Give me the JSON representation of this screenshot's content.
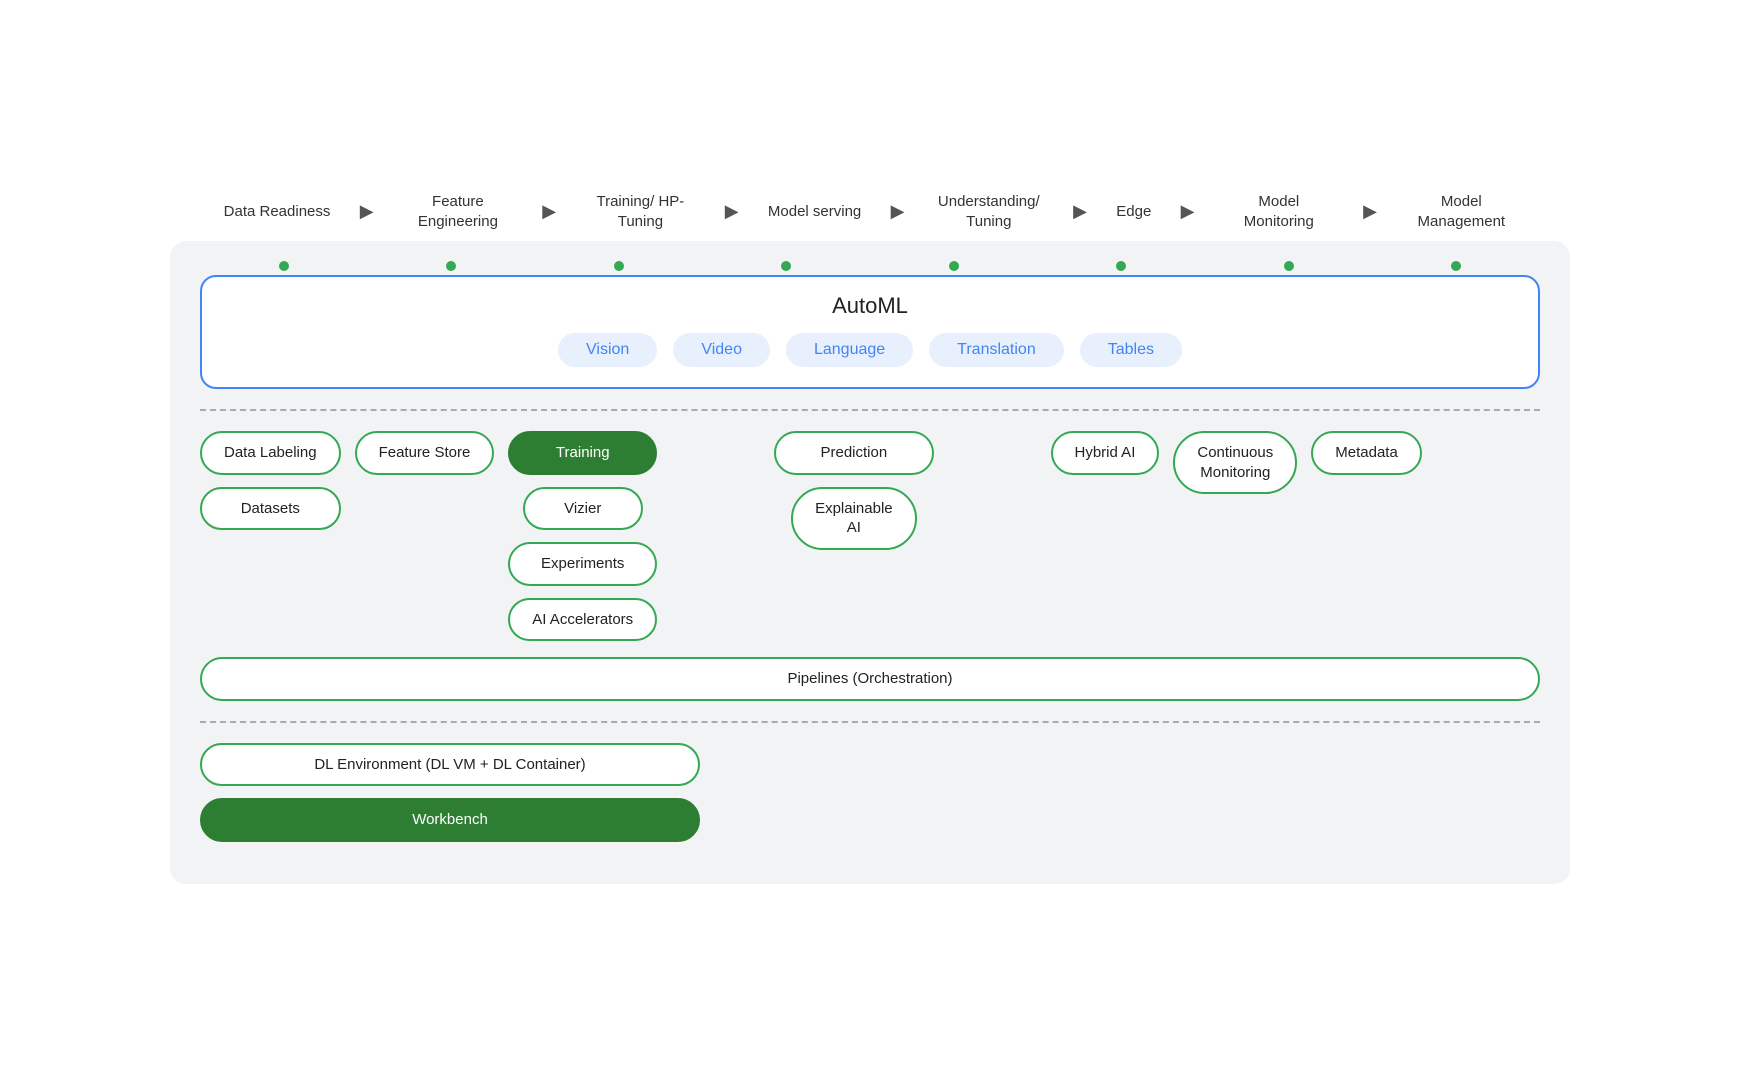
{
  "pipeline": {
    "steps": [
      {
        "label": "Data Readiness"
      },
      {
        "label": "Feature Engineering"
      },
      {
        "label": "Training/ HP-Tuning"
      },
      {
        "label": "Model serving"
      },
      {
        "label": "Understanding/ Tuning"
      },
      {
        "label": "Edge"
      },
      {
        "label": "Model Monitoring"
      },
      {
        "label": "Model Management"
      }
    ]
  },
  "automl": {
    "title": "AutoML",
    "pills": [
      "Vision",
      "Video",
      "Language",
      "Translation",
      "Tables"
    ]
  },
  "row1": {
    "items": [
      {
        "label": "Data Labeling",
        "filled": false
      },
      {
        "label": "Feature Store",
        "filled": false
      },
      {
        "label": "Training",
        "filled": true
      },
      {
        "label": "",
        "spacer": true
      },
      {
        "label": "Prediction",
        "filled": false
      },
      {
        "label": "Hybrid AI",
        "filled": false
      },
      {
        "label": "Continuous Monitoring",
        "filled": false
      },
      {
        "label": "Metadata",
        "filled": false
      }
    ]
  },
  "row2": {
    "items": [
      {
        "label": "Datasets",
        "filled": false
      },
      {
        "label": "",
        "spacer": true
      },
      {
        "label": "Vizier",
        "filled": false
      },
      {
        "label": "",
        "spacer": true
      },
      {
        "label": "Explainable AI",
        "filled": false
      }
    ]
  },
  "row3": {
    "items": [
      {
        "label": "Experiments",
        "filled": false
      }
    ]
  },
  "row4": {
    "items": [
      {
        "label": "AI Accelerators",
        "filled": false
      }
    ]
  },
  "pipelines_row": {
    "label": "Pipelines (Orchestration)"
  },
  "dl_env": {
    "label": "DL Environment (DL VM + DL Container)"
  },
  "workbench": {
    "label": "Workbench"
  }
}
